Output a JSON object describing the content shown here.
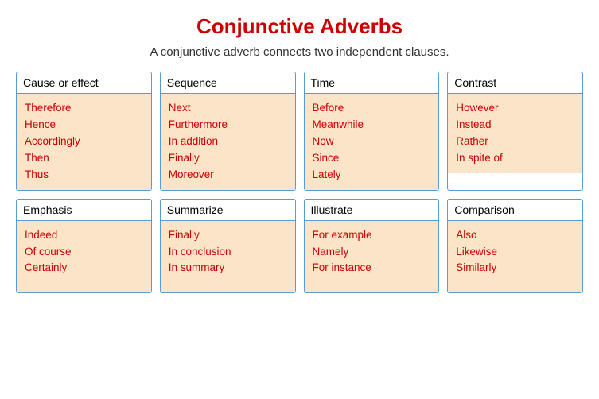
{
  "title": "Conjunctive Adverbs",
  "subtitle": "A conjunctive adverb connects two independent clauses.",
  "cards": [
    {
      "header": "Cause or effect",
      "items": [
        "Therefore",
        "Hence",
        "Accordingly",
        "Then",
        "Thus"
      ]
    },
    {
      "header": "Sequence",
      "items": [
        "Next",
        "Furthermore",
        "In addition",
        "Finally",
        "Moreover"
      ]
    },
    {
      "header": "Time",
      "items": [
        "Before",
        "Meanwhile",
        "Now",
        "Since",
        "Lately"
      ]
    },
    {
      "header": "Contrast",
      "items": [
        "However",
        "Instead",
        "Rather",
        "In spite of"
      ]
    },
    {
      "header": "Emphasis",
      "items": [
        "Indeed",
        "Of course",
        "Certainly"
      ]
    },
    {
      "header": "Summarize",
      "items": [
        "Finally",
        "In conclusion",
        "In summary"
      ]
    },
    {
      "header": "Illustrate",
      "items": [
        "For example",
        "Namely",
        "For instance"
      ]
    },
    {
      "header": "Comparison",
      "items": [
        "Also",
        "Likewise",
        "Similarly"
      ]
    }
  ]
}
